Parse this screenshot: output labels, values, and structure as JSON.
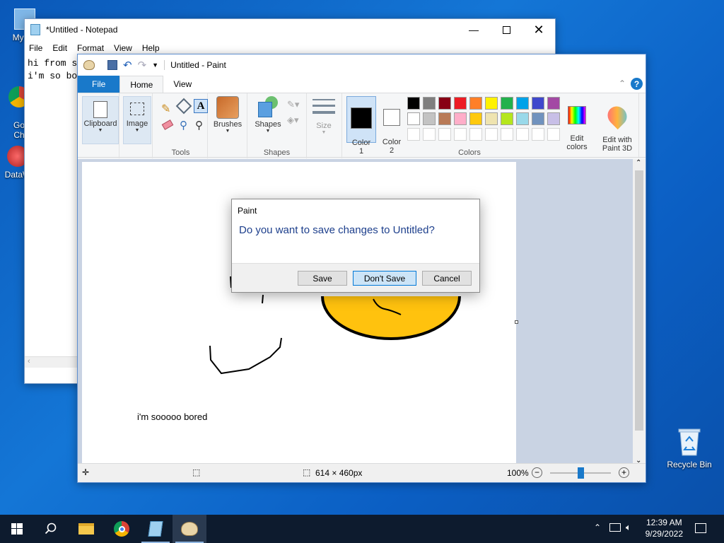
{
  "desktop": {
    "icons": [
      {
        "label": "My Co",
        "icon": "computer-icon"
      },
      {
        "label": "Go\nCh",
        "icon": "chrome-icon"
      },
      {
        "label": "DataW",
        "icon": "datawrangler-icon"
      }
    ],
    "recycle_bin": {
      "label": "Recycle Bin",
      "icon": "recycle-bin-icon"
    }
  },
  "notepad": {
    "title": "*Untitled - Notepad",
    "menu": [
      "File",
      "Edit",
      "Format",
      "View",
      "Help"
    ],
    "lines": [
      "hi from s",
      "i'm so bo"
    ]
  },
  "paint": {
    "title": "Untitled - Paint",
    "tabs": {
      "file": "File",
      "home": "Home",
      "view": "View"
    },
    "groups": {
      "clipboard": "Clipboard",
      "image": "Image",
      "tools": "Tools",
      "brushes": "Brushes",
      "shapes_btn": "Shapes",
      "shapes": "Shapes",
      "size": "Size",
      "color1": "Color\n1",
      "color2": "Color\n2",
      "colors": "Colors",
      "edit_colors": "Edit\ncolors",
      "edit_3d": "Edit with\nPaint 3D"
    },
    "palette_row1": [
      "#000000",
      "#7f7f7f",
      "#880015",
      "#ed1c24",
      "#ff7f27",
      "#fff200",
      "#22b14c",
      "#00a2e8",
      "#3f48cc",
      "#a349a4"
    ],
    "palette_row2": [
      "#ffffff",
      "#c3c3c3",
      "#b97a57",
      "#ffaec9",
      "#ffc90e",
      "#efe4b0",
      "#b5e61d",
      "#99d9ea",
      "#7092be",
      "#c8bfe7"
    ],
    "canvas_text": "i'm sooooo bored",
    "status": {
      "dimensions": "614 × 460px",
      "zoom": "100%"
    }
  },
  "dialog": {
    "title": "Paint",
    "message": "Do you want to save changes to Untitled?",
    "buttons": {
      "save": "Save",
      "dont_save": "Don't Save",
      "cancel": "Cancel"
    }
  },
  "taskbar": {
    "time": "12:39 AM",
    "date": "9/29/2022"
  }
}
